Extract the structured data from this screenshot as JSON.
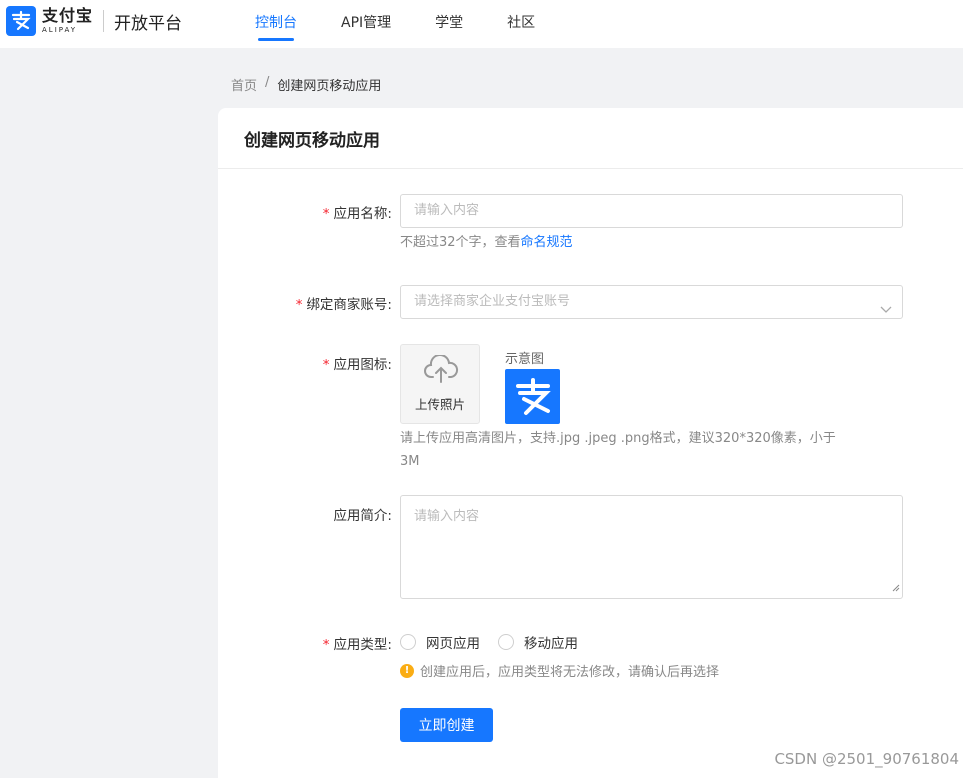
{
  "header": {
    "logo_cn": "支付宝",
    "logo_en": "ALIPAY",
    "platform": "开放平台",
    "nav": [
      {
        "label": "控制台",
        "active": true
      },
      {
        "label": "API管理",
        "active": false
      },
      {
        "label": "学堂",
        "active": false
      },
      {
        "label": "社区",
        "active": false
      }
    ]
  },
  "breadcrumb": {
    "home": "首页",
    "separator": "/",
    "current": "创建网页移动应用"
  },
  "form": {
    "title": "创建网页移动应用",
    "name": {
      "label": "应用名称:",
      "required": "*",
      "placeholder": "请输入内容",
      "hint": "不超过32个字，查看",
      "hint_link": "命名规范"
    },
    "merchant": {
      "label": "绑定商家账号:",
      "required": "*",
      "placeholder": "请选择商家企业支付宝账号",
      "icon": "chevron-down-icon"
    },
    "icon_upload": {
      "label": "应用图标:",
      "required": "*",
      "button": "上传照片",
      "demo_label": "示意图",
      "hint": "请上传应用高清图片，支持.jpg .jpeg .png格式，建议320*320像素，小于",
      "hint2": "3M"
    },
    "intro": {
      "label": "应用简介:",
      "placeholder": "请输入内容"
    },
    "type": {
      "label": "应用类型:",
      "required": "*",
      "options": [
        "网页应用",
        "移动应用"
      ],
      "warning": "创建应用后，应用类型将无法修改，请确认后再选择",
      "warning_icon": "!"
    },
    "submit": "立即创建"
  },
  "watermark": "CSDN @2501_90761804",
  "colors": {
    "accent": "#1677ff",
    "required": "#f5222d",
    "warning": "#faad14"
  }
}
